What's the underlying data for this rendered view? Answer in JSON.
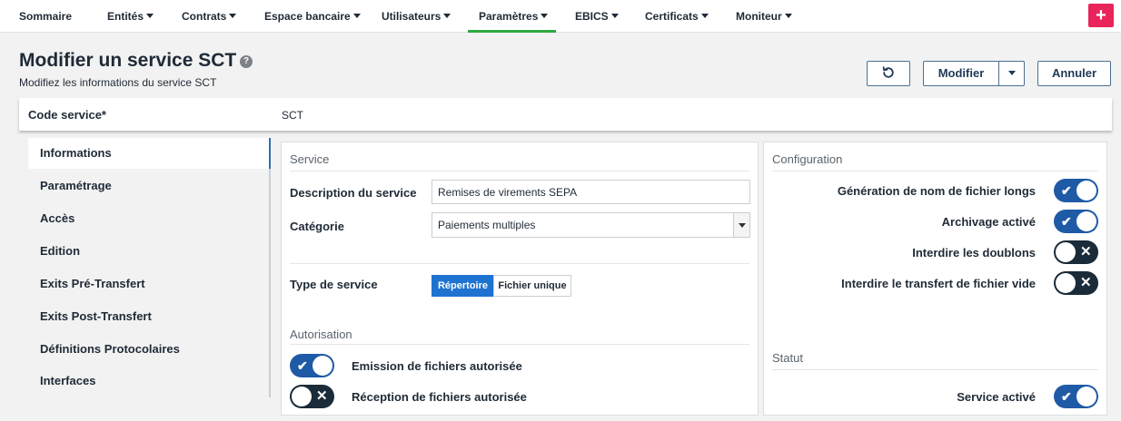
{
  "nav": {
    "items": [
      {
        "label": "Sommaire",
        "caret": false
      },
      {
        "label": "Entités",
        "caret": true
      },
      {
        "label": "Contrats",
        "caret": true
      },
      {
        "label": "Espace bancaire",
        "caret": true
      },
      {
        "label": "Utilisateurs",
        "caret": true
      },
      {
        "label": "Paramètres",
        "caret": true,
        "active": true
      },
      {
        "label": "EBICS",
        "caret": true
      },
      {
        "label": "Certificats",
        "caret": true
      },
      {
        "label": "Moniteur",
        "caret": true
      }
    ],
    "plus_label": "+",
    "active_color": "#2eaa3f"
  },
  "header": {
    "title": "Modifier un service SCT",
    "help_glyph": "?",
    "subtitle": "Modifiez les informations du service SCT"
  },
  "actions": {
    "refresh_icon": "refresh-icon",
    "modify_label": "Modifier",
    "cancel_label": "Annuler"
  },
  "code_service": {
    "label": "Code service*",
    "value": "SCT"
  },
  "side_menu": {
    "items": [
      {
        "label": "Informations",
        "active": true
      },
      {
        "label": "Paramétrage"
      },
      {
        "label": "Accès"
      },
      {
        "label": "Edition"
      },
      {
        "label": "Exits Pré-Transfert"
      },
      {
        "label": "Exits Post-Transfert"
      },
      {
        "label": "Définitions Protocolaires"
      },
      {
        "label": "Interfaces"
      }
    ]
  },
  "service": {
    "section_title": "Service",
    "description_label": "Description du service",
    "description_value": "Remises de virements SEPA",
    "category_label": "Catégorie",
    "category_value": "Paiements multiples",
    "type_label": "Type de service",
    "type_options": [
      "Répertoire",
      "Fichier unique"
    ],
    "type_selected": "Répertoire"
  },
  "autorisation": {
    "section_title": "Autorisation",
    "toggles": [
      {
        "label": "Emission de fichiers autorisée",
        "on": true
      },
      {
        "label": "Réception de fichiers autorisée",
        "on": false
      }
    ]
  },
  "configuration": {
    "section_title": "Configuration",
    "toggles": [
      {
        "label": "Génération de nom de fichier longs",
        "on": true
      },
      {
        "label": "Archivage activé",
        "on": true
      },
      {
        "label": "Interdire les doublons",
        "on": false
      },
      {
        "label": "Interdire le transfert de fichier vide",
        "on": false
      }
    ]
  },
  "statut": {
    "section_title": "Statut",
    "toggle": {
      "label": "Service activé",
      "on": true
    }
  },
  "colors": {
    "toggle_on": "#1f5aa6",
    "toggle_off": "#1a2b3a",
    "primary": "#1f73d0",
    "accent_pink": "#e8245a"
  }
}
